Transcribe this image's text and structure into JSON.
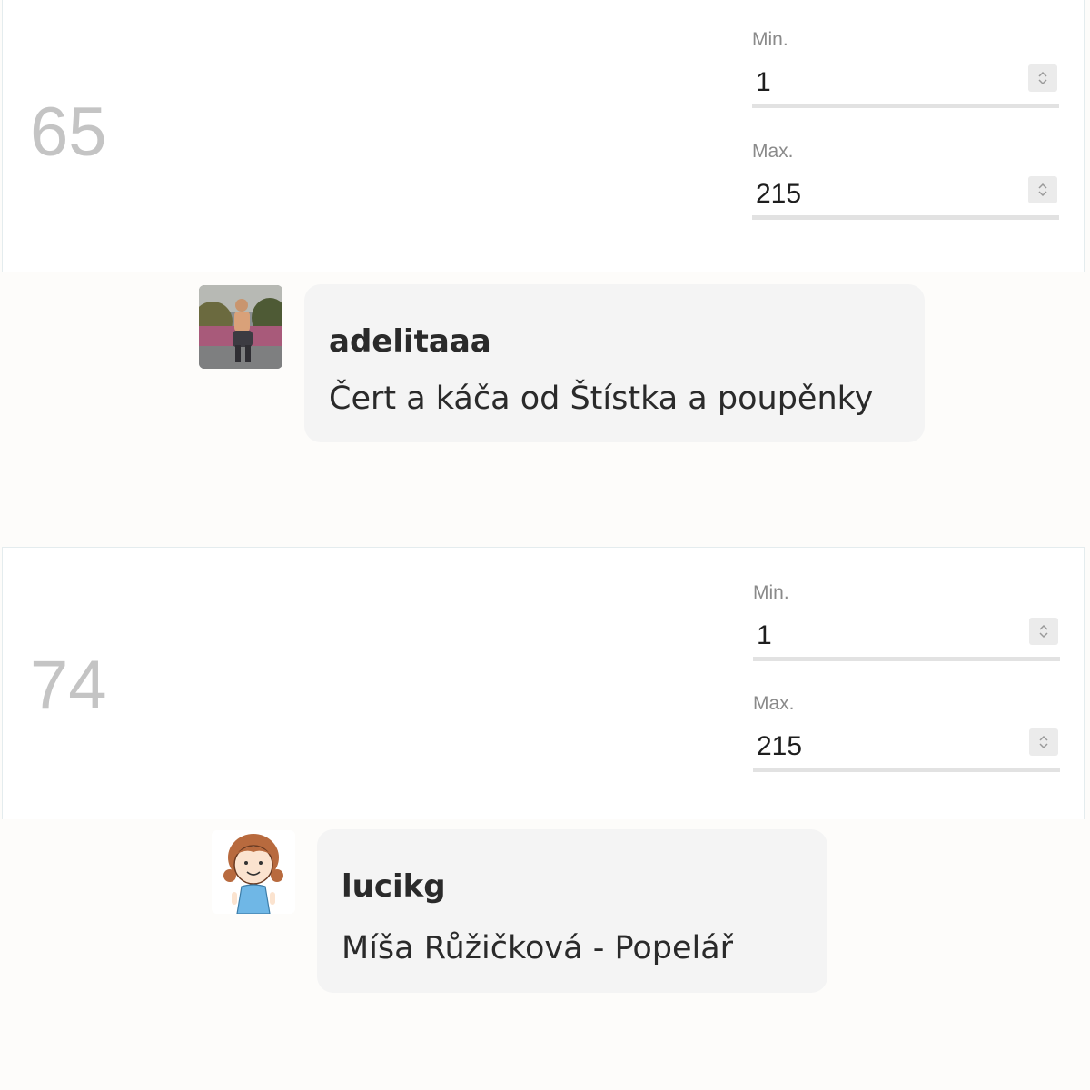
{
  "items": [
    {
      "number": "65",
      "min_label": "Min.",
      "min_value": "1",
      "max_label": "Max.",
      "max_value": "215"
    },
    {
      "number": "74",
      "min_label": "Min.",
      "min_value": "1",
      "max_label": "Max.",
      "max_value": "215"
    }
  ],
  "comments": [
    {
      "username": "adelitaaa",
      "text": "Čert a káča od Štístka a poupěnky",
      "avatar_icon": "photo-avatar"
    },
    {
      "username": "lucikg",
      "text": "Míša Růžičková - Popelář",
      "avatar_icon": "cartoon-girl-avatar"
    }
  ],
  "colors": {
    "page_background": "#fdfcfa",
    "bubble_background": "#f4f4f4",
    "big_number": "#c4c4c4",
    "underline": "#e2e2e2"
  }
}
